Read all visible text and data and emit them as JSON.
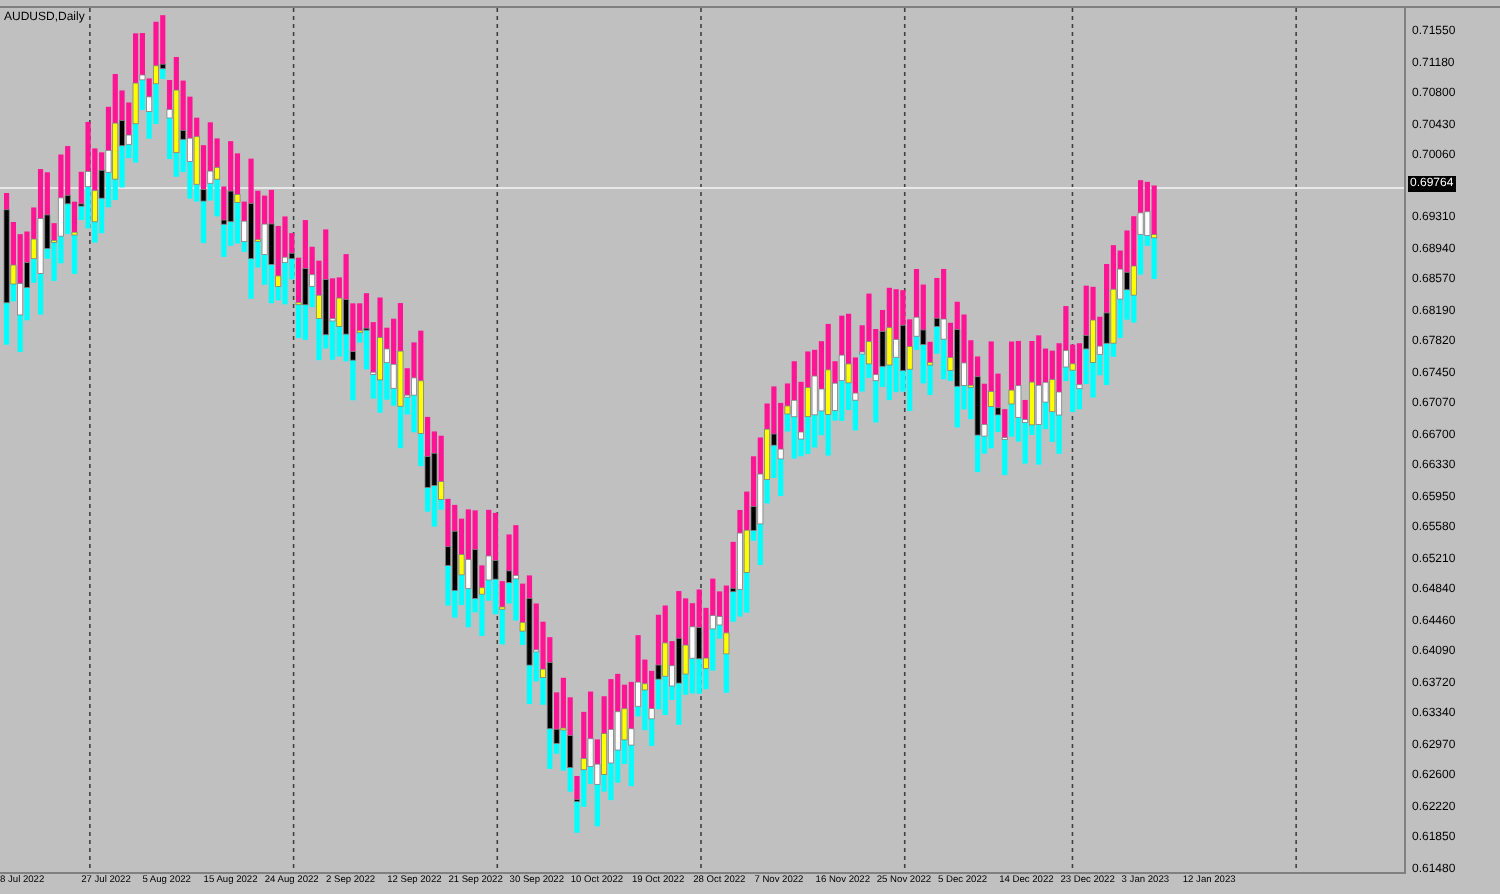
{
  "chart": {
    "title": "AUDUSD,Daily",
    "current_price": "0.69764",
    "price_labels": [
      "0.71550",
      "0.71180",
      "0.70800",
      "0.70430",
      "0.70060",
      "0.69310",
      "0.68940",
      "0.68570",
      "0.68190",
      "0.67820",
      "0.67450",
      "0.67070",
      "0.66700",
      "0.66330",
      "0.65950",
      "0.65580",
      "0.65210",
      "0.64840",
      "0.64460",
      "0.64090",
      "0.63720",
      "0.63340",
      "0.62970",
      "0.62600",
      "0.62220",
      "0.61850",
      "0.61480"
    ],
    "date_labels": [
      "8 Jul 2022",
      "27 Jul 2022",
      "5 Aug 2022",
      "15 Aug 2022",
      "24 Aug 2022",
      "2 Sep 2022",
      "12 Sep 2022",
      "21 Sep 2022",
      "30 Sep 2022",
      "10 Oct 2022",
      "19 Oct 2022",
      "28 Oct 2022",
      "7 Nov 2022",
      "16 Nov 2022",
      "25 Nov 2022",
      "5 Dec 2022",
      "14 Dec 2022",
      "23 Dec 2022",
      "3 Jan 2023",
      "12 Jan 2023"
    ]
  }
}
